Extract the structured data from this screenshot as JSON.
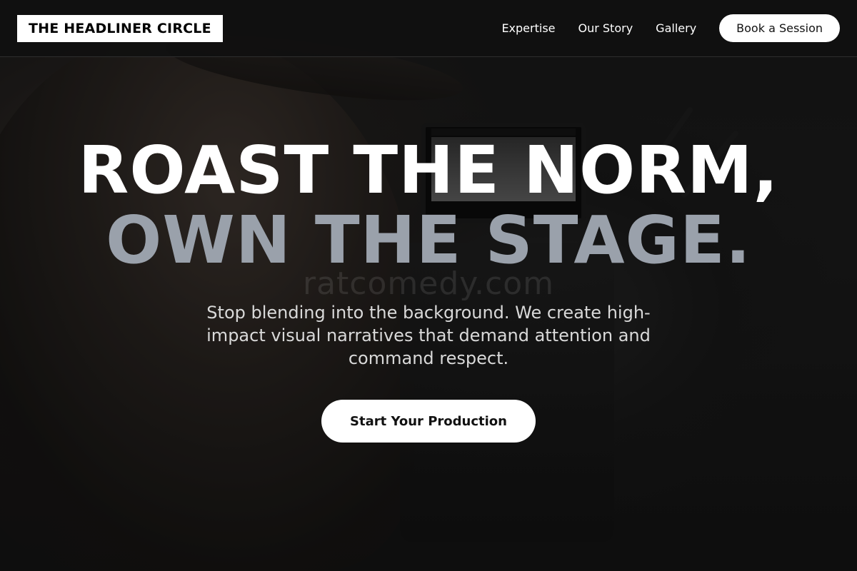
{
  "brand": {
    "name": "THE HEADLINER CIRCLE"
  },
  "nav": {
    "links": [
      "Expertise",
      "Our Story",
      "Gallery"
    ],
    "cta_label": "Book a Session"
  },
  "hero": {
    "headline_line1": "ROAST THE NORM,",
    "headline_line2": "OWN THE STAGE.",
    "subtitle": "Stop blending into the background. We create high-impact visual narratives that demand attention and command respect.",
    "cta_label": "Start Your Production",
    "watermark": "ratcomedy.com"
  },
  "colors": {
    "background": "#141414",
    "accent_white": "#ffffff",
    "headline_secondary": "#9aa1ab"
  }
}
